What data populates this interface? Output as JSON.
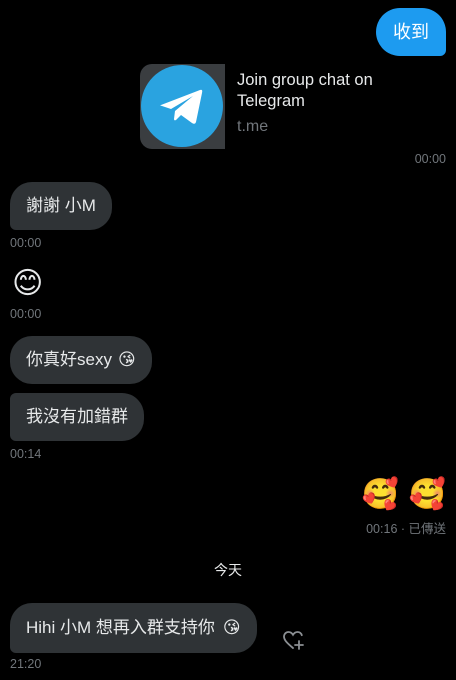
{
  "messages": {
    "out_received": "收到",
    "link_card": {
      "title_line1": "Join group chat on",
      "title_line2": "Telegram",
      "domain": "t.me",
      "time": "00:00",
      "logo_icon": "telegram-paper-plane-icon",
      "logo_color": "#2aa3e0"
    },
    "in_1": {
      "text": "謝謝 小M",
      "time": "00:00"
    },
    "in_2": {
      "emoji": "😊",
      "time": "00:00"
    },
    "in_3": {
      "text": "你真好sexy",
      "emoji": "😘"
    },
    "in_4": {
      "text": "我沒有加錯群",
      "time": "00:14"
    },
    "out_emojis": {
      "emoji1": "🥰",
      "emoji2": "🥰",
      "status": "00:16 · 已傳送"
    },
    "date_divider": "今天",
    "in_5": {
      "text": "Hihi 小M 想再入群支持你",
      "emoji": "😘",
      "time": "21:20"
    },
    "react_icon": "heart-plus-icon"
  },
  "colors": {
    "outgoing_bubble": "#1d9bf0",
    "incoming_bubble": "#2f3336",
    "background": "#000000"
  }
}
